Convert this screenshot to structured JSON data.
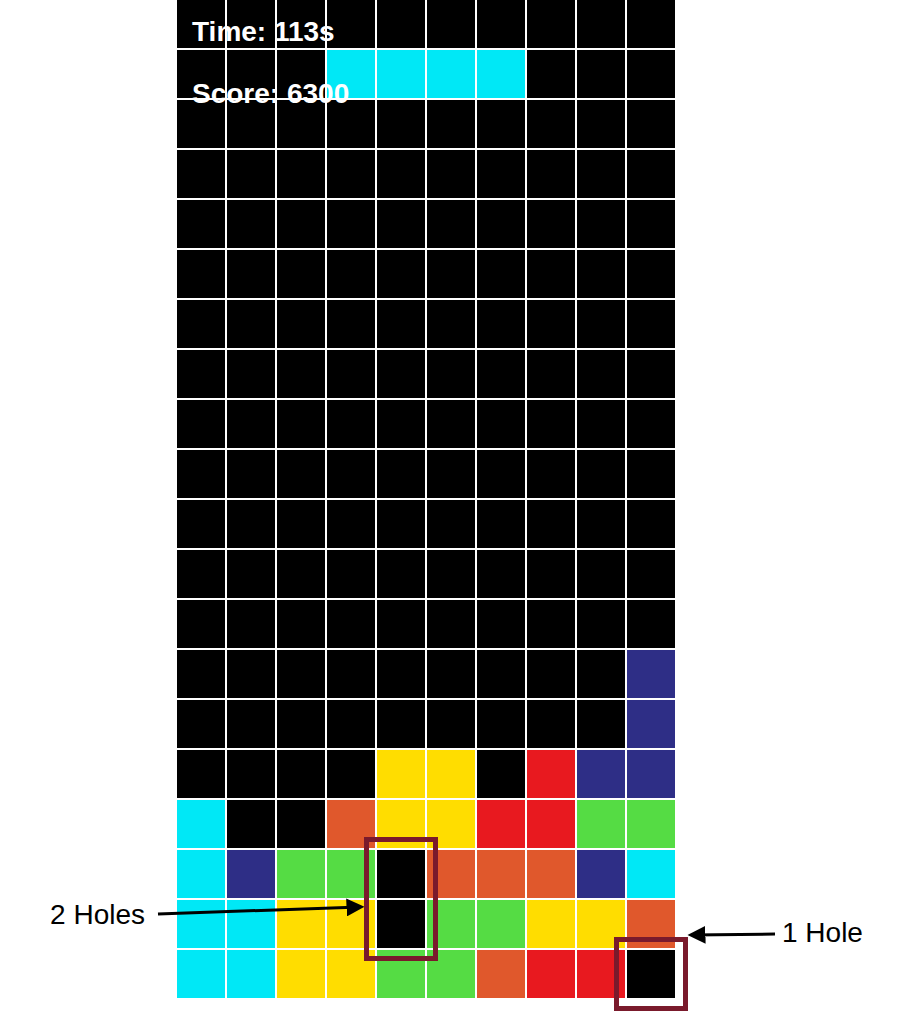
{
  "hud": {
    "time": "Time: 113s",
    "score": "Score: 6300"
  },
  "board": {
    "rows": [
      [
        null,
        null,
        null,
        null,
        null,
        null,
        null,
        null,
        null,
        null
      ],
      [
        null,
        null,
        null,
        "#00e8f6",
        "#00e8f6",
        "#00e8f6",
        "#00e8f6",
        null,
        null,
        null
      ],
      [
        null,
        null,
        null,
        null,
        null,
        null,
        null,
        null,
        null,
        null
      ],
      [
        null,
        null,
        null,
        null,
        null,
        null,
        null,
        null,
        null,
        null
      ],
      [
        null,
        null,
        null,
        null,
        null,
        null,
        null,
        null,
        null,
        null
      ],
      [
        null,
        null,
        null,
        null,
        null,
        null,
        null,
        null,
        null,
        null
      ],
      [
        null,
        null,
        null,
        null,
        null,
        null,
        null,
        null,
        null,
        null
      ],
      [
        null,
        null,
        null,
        null,
        null,
        null,
        null,
        null,
        null,
        null
      ],
      [
        null,
        null,
        null,
        null,
        null,
        null,
        null,
        null,
        null,
        null
      ],
      [
        null,
        null,
        null,
        null,
        null,
        null,
        null,
        null,
        null,
        null
      ],
      [
        null,
        null,
        null,
        null,
        null,
        null,
        null,
        null,
        null,
        null
      ],
      [
        null,
        null,
        null,
        null,
        null,
        null,
        null,
        null,
        null,
        null
      ],
      [
        null,
        null,
        null,
        null,
        null,
        null,
        null,
        null,
        null,
        null
      ],
      [
        null,
        null,
        null,
        null,
        null,
        null,
        null,
        null,
        null,
        "#2e2e86"
      ],
      [
        null,
        null,
        null,
        null,
        null,
        null,
        null,
        null,
        null,
        "#2e2e86"
      ],
      [
        null,
        null,
        null,
        null,
        "#ffdd00",
        "#ffdd00",
        null,
        "#e8191f",
        "#2e2e86",
        "#2e2e86"
      ],
      [
        "#00e8f6",
        null,
        null,
        "#e0582c",
        "#ffdd00",
        "#ffdd00",
        "#e8191f",
        "#e8191f",
        "#55dc44",
        "#55dc44"
      ],
      [
        "#00e8f6",
        "#2e2e86",
        "#55dc44",
        "#55dc44",
        null,
        "#e0582c",
        "#e0582c",
        "#e0582c",
        "#2e2e86",
        "#00e8f6"
      ],
      [
        "#00e8f6",
        "#00e8f6",
        "#ffdd00",
        "#ffdd00",
        null,
        "#55dc44",
        "#55dc44",
        "#ffdd00",
        "#ffdd00",
        "#e0582c"
      ],
      [
        "#00e8f6",
        "#00e8f6",
        "#ffdd00",
        "#ffdd00",
        "#55dc44",
        "#55dc44",
        "#e0582c",
        "#e8191f",
        "#e8191f",
        null
      ]
    ]
  },
  "annotations": [
    {
      "label": "2 Holes",
      "side": "left",
      "row": 17,
      "col": 4,
      "rows": 2,
      "cols": 1
    },
    {
      "label": "1 Hole",
      "side": "right",
      "row": 19,
      "col": 9,
      "rows": 1,
      "cols": 1
    }
  ]
}
